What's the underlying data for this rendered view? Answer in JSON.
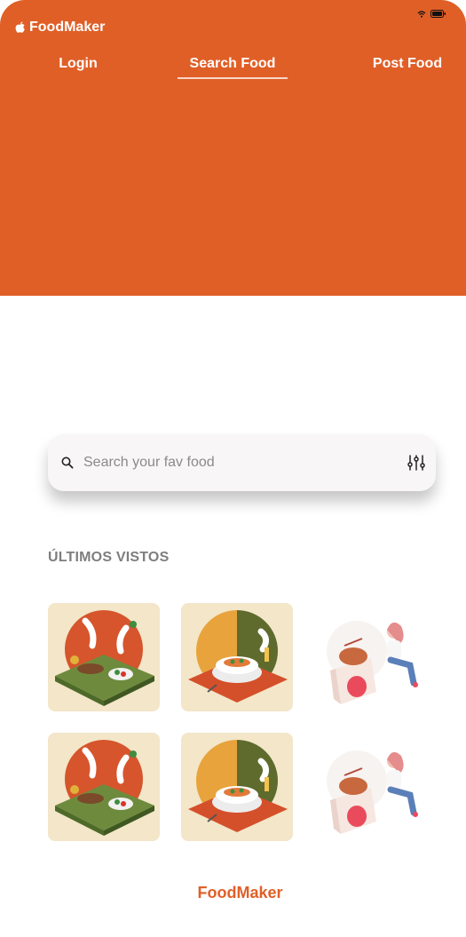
{
  "app": {
    "name": "FoodMaker"
  },
  "nav": {
    "items": [
      "Login",
      "Search Food",
      "Post Food"
    ],
    "active": "Search Food"
  },
  "search": {
    "placeholder": "Search your fav food",
    "value": ""
  },
  "recent": {
    "title": "ÚLTIMOS VISTOS",
    "items": [
      {
        "icon": "cooking-salad-illustration"
      },
      {
        "icon": "plated-meal-illustration"
      },
      {
        "icon": "noodle-girl-illustration"
      },
      {
        "icon": "cooking-salad-illustration"
      },
      {
        "icon": "plated-meal-illustration"
      },
      {
        "icon": "noodle-girl-illustration"
      }
    ]
  },
  "footer": {
    "brand": "FoodMaker"
  },
  "colors": {
    "accent": "#E05F27",
    "tile": "#F3E6C9",
    "text_muted": "#7E7E7E"
  }
}
